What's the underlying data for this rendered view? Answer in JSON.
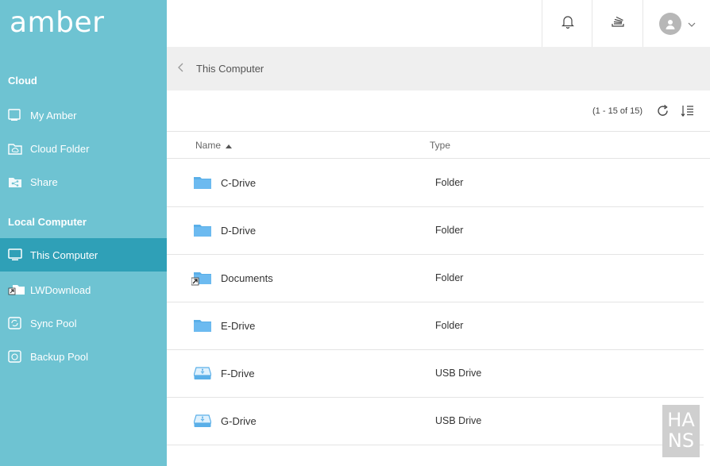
{
  "app": {
    "logo": "amber"
  },
  "sidebar": {
    "cloud_title": "Cloud",
    "cloud_items": [
      {
        "label": "My Amber",
        "icon": "my-amber-icon"
      },
      {
        "label": "Cloud Folder",
        "icon": "cloud-folder-icon"
      },
      {
        "label": "Share",
        "icon": "share-icon"
      }
    ],
    "local_title": "Local Computer",
    "local_items": [
      {
        "label": "This Computer",
        "icon": "monitor-icon",
        "active": true
      },
      {
        "label": "LWDownload",
        "icon": "shortcut-folder-icon"
      },
      {
        "label": "Sync Pool",
        "icon": "sync-pool-icon"
      },
      {
        "label": "Backup Pool",
        "icon": "backup-pool-icon"
      }
    ]
  },
  "breadcrumb": {
    "current": "This Computer"
  },
  "toolbar": {
    "count": "(1 - 15 of 15)"
  },
  "table": {
    "columns": [
      "Name",
      "Type"
    ],
    "sort": {
      "column": "Name",
      "direction": "ascending"
    },
    "rows": [
      {
        "name": "C-Drive",
        "type": "Folder",
        "icon": "folder-icon"
      },
      {
        "name": "D-Drive",
        "type": "Folder",
        "icon": "folder-icon"
      },
      {
        "name": "Documents",
        "type": "Folder",
        "icon": "shortcut-folder-icon"
      },
      {
        "name": "E-Drive",
        "type": "Folder",
        "icon": "folder-icon"
      },
      {
        "name": "F-Drive",
        "type": "USB Drive",
        "icon": "usb-drive-icon"
      },
      {
        "name": "G-Drive",
        "type": "USB Drive",
        "icon": "usb-drive-icon"
      }
    ]
  },
  "watermark": {
    "line1": "HA",
    "line2": "NS"
  },
  "colors": {
    "sidebar": "#6ec3d2",
    "active": "#2fa0b7",
    "folder": "#5aafe8"
  }
}
